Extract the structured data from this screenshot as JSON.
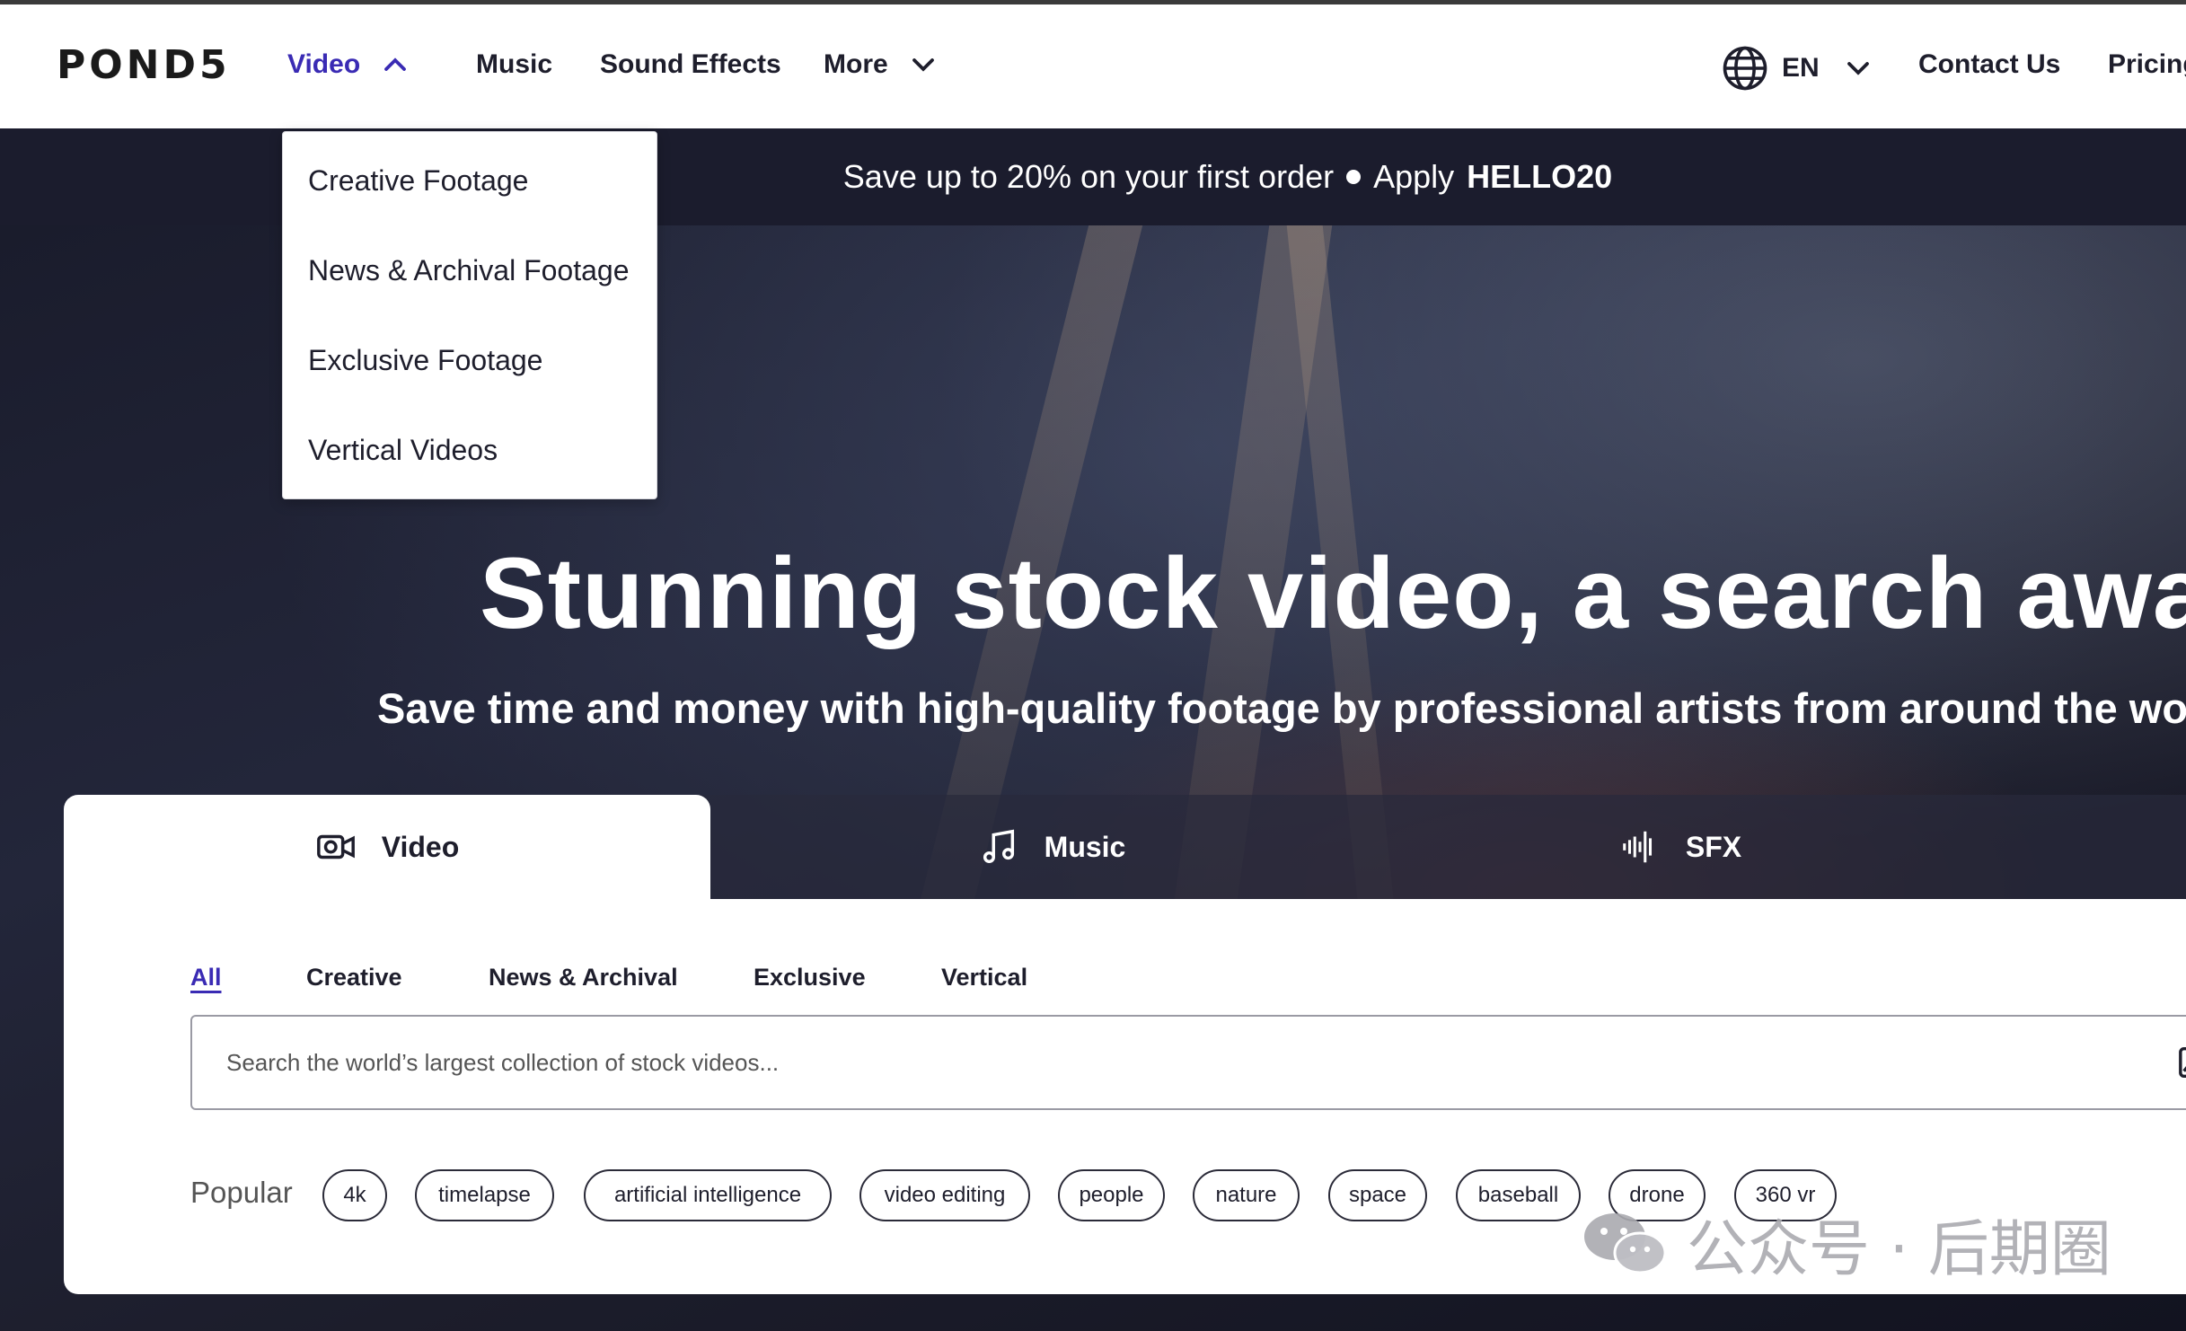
{
  "brand": {
    "logo_text": "POND5"
  },
  "nav": {
    "video": "Video",
    "music": "Music",
    "sound_effects": "Sound Effects",
    "more": "More",
    "language": "EN",
    "contact": "Contact Us",
    "pricing": "Pricing"
  },
  "video_menu": {
    "items": [
      "Creative Footage",
      "News & Archival Footage",
      "Exclusive Footage",
      "Vertical Videos"
    ]
  },
  "promo": {
    "text": "Save up to 20% on your first order",
    "apply": "Apply",
    "code": "HELLO20"
  },
  "hero": {
    "title": "Stunning stock video, a search away",
    "subtitle": "Save time and money with high-quality footage by professional artists from around the world"
  },
  "search_panel": {
    "tabs": [
      "Video",
      "Music",
      "SFX"
    ],
    "subtabs": [
      "All",
      "Creative",
      "News & Archival",
      "Exclusive",
      "Vertical"
    ],
    "placeholder": "Search the world’s largest collection of stock videos...",
    "popular_label": "Popular",
    "popular_tags": [
      "4k",
      "timelapse",
      "artificial intelligence",
      "video editing",
      "people",
      "nature",
      "space",
      "baseball",
      "drone",
      "360 vr"
    ]
  },
  "watermark": {
    "text": "公众号 · 后期圈"
  },
  "colors": {
    "accent": "#3a2bb4",
    "promo_bg": "#1b1c2d",
    "text_dark": "#1e1e2c"
  },
  "icons": {
    "video_chevron": "chevron-up-icon",
    "more_chevron": "chevron-down-icon",
    "language": "globe-icon",
    "video_tab": "video-camera-icon",
    "music_tab": "music-note-icon",
    "sfx_tab": "sound-wave-icon",
    "image_search": "image-search-icon"
  }
}
